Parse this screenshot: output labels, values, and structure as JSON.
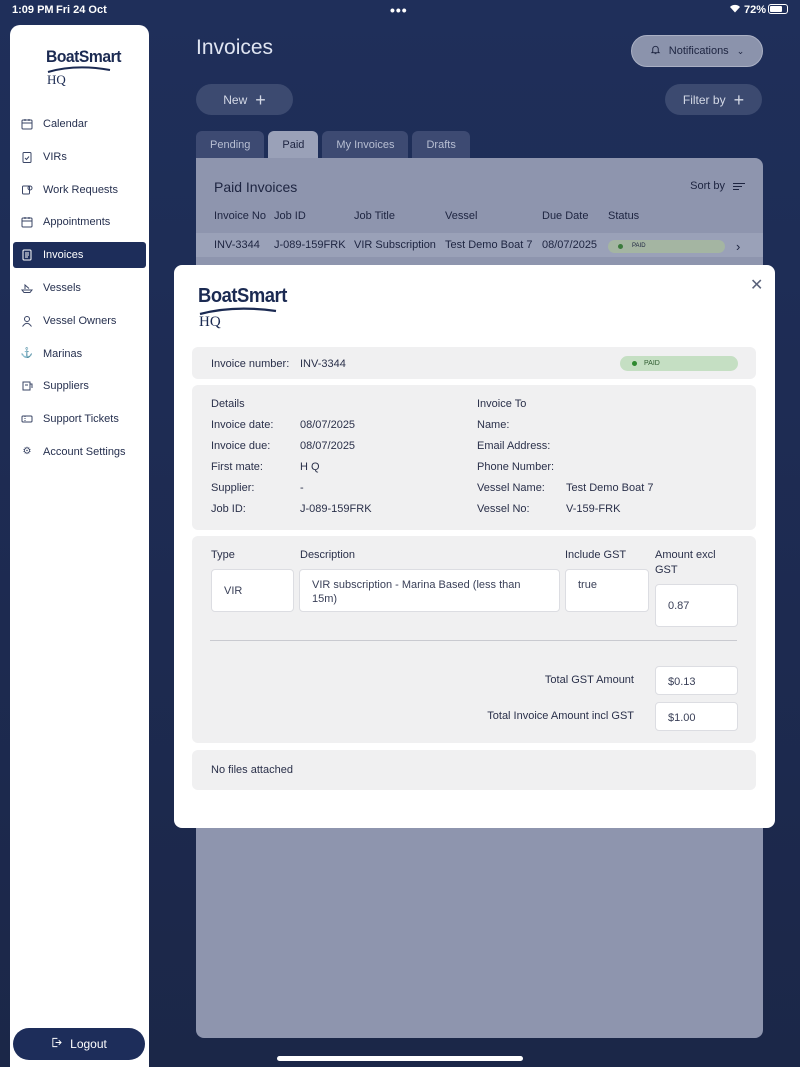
{
  "status_bar": {
    "time": "1:09 PM",
    "date": "Fri 24 Oct",
    "battery": "72%"
  },
  "logo": {
    "top": "BoatSmart",
    "bottom": "HQ"
  },
  "sidebar": {
    "items": [
      {
        "label": "Calendar",
        "icon": "calendar-icon"
      },
      {
        "label": "VIRs",
        "icon": "clipboard-check-icon"
      },
      {
        "label": "Work Requests",
        "icon": "work-request-icon"
      },
      {
        "label": "Appointments",
        "icon": "calendar-icon"
      },
      {
        "label": "Invoices",
        "icon": "invoice-icon",
        "active": true
      },
      {
        "label": "Vessels",
        "icon": "boat-icon"
      },
      {
        "label": "Vessel Owners",
        "icon": "person-icon"
      },
      {
        "label": "Marinas",
        "icon": "anchor-icon"
      },
      {
        "label": "Suppliers",
        "icon": "supplier-icon"
      },
      {
        "label": "Support Tickets",
        "icon": "ticket-icon"
      },
      {
        "label": "Account Settings",
        "icon": "gear-icon"
      }
    ],
    "logout_label": "Logout"
  },
  "header": {
    "title": "Invoices",
    "notifications_label": "Notifications",
    "new_label": "New",
    "filter_label": "Filter by"
  },
  "tabs": [
    {
      "label": "Pending"
    },
    {
      "label": "Paid",
      "active": true
    },
    {
      "label": "My Invoices"
    },
    {
      "label": "Drafts"
    }
  ],
  "panel": {
    "title": "Paid Invoices",
    "sort_label": "Sort by",
    "columns": [
      "Invoice No",
      "Job ID",
      "Job Title",
      "Vessel",
      "Due Date",
      "Status"
    ],
    "rows": [
      {
        "invoice_no": "INV-3344",
        "job_id": "J-089-159FRK",
        "job_title": "VIR Subscription",
        "vessel": "Test Demo Boat 7",
        "due_date": "08/07/2025",
        "status": "PAID"
      }
    ]
  },
  "modal": {
    "invoice_number_label": "Invoice number:",
    "invoice_number": "INV-3344",
    "status": "PAID",
    "details": {
      "heading": "Details",
      "invoice_date_label": "Invoice date:",
      "invoice_date": "08/07/2025",
      "invoice_due_label": "Invoice due:",
      "invoice_due": "08/07/2025",
      "first_mate_label": "First mate:",
      "first_mate": "H Q",
      "supplier_label": "Supplier:",
      "supplier": "-",
      "job_id_label": "Job ID:",
      "job_id": "J-089-159FRK"
    },
    "invoice_to": {
      "heading": "Invoice To",
      "name_label": "Name:",
      "email_label": "Email Address:",
      "phone_label": "Phone Number:",
      "vessel_name_label": "Vessel Name:",
      "vessel_name": "Test Demo Boat 7",
      "vessel_no_label": "Vessel No:",
      "vessel_no": "V-159-FRK"
    },
    "items": {
      "type_header": "Type",
      "description_header": "Description",
      "gst_header": "Include GST",
      "amount_header": "Amount excl GST",
      "type": "VIR",
      "description": "VIR subscription - Marina Based (less than 15m)",
      "include_gst": "true",
      "amount": "0.87"
    },
    "totals": {
      "gst_label": "Total GST Amount",
      "gst_value": "$0.13",
      "total_label": "Total Invoice Amount incl GST",
      "total_value": "$1.00"
    },
    "files_text": "No files attached"
  }
}
